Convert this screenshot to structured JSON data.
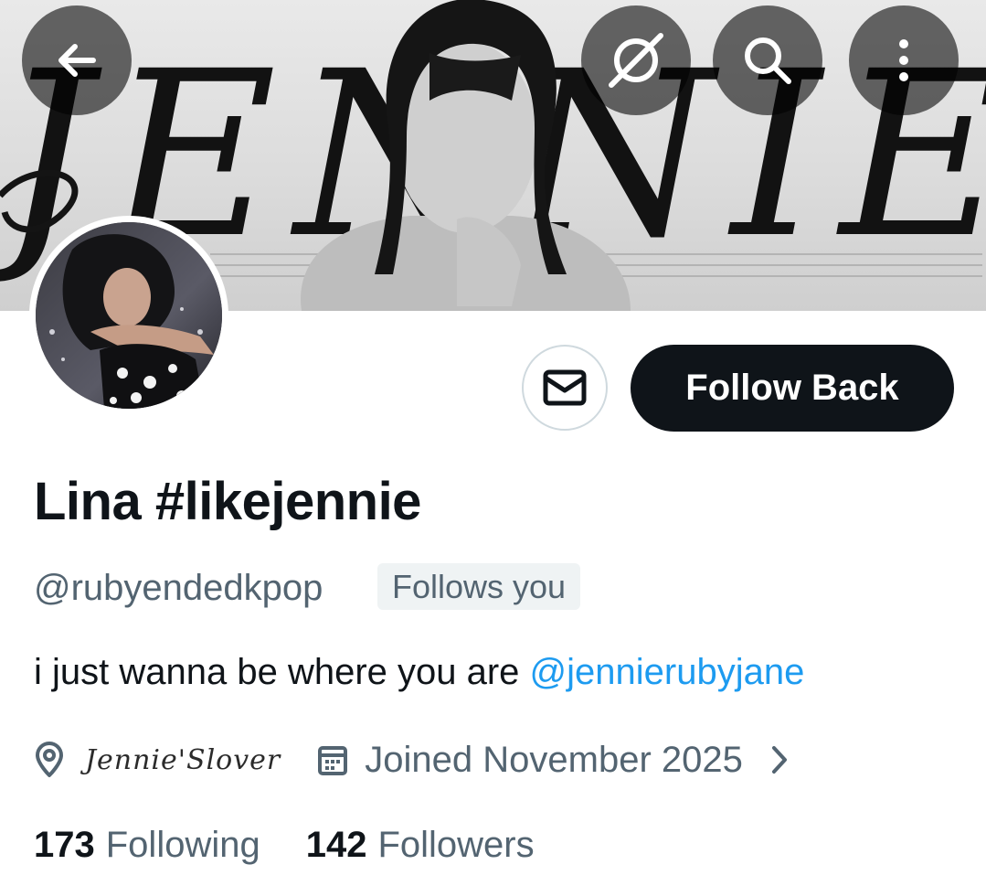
{
  "banner": {
    "wordmark": "JENNIE"
  },
  "nav": {
    "back_icon": "arrow-left-icon",
    "mute_icon": "no-grok-icon",
    "search_icon": "search-icon",
    "more_icon": "more-vertical-icon"
  },
  "profile": {
    "display_name": "Lina #likejennie",
    "handle": "@rubyendedkpop",
    "follows_you": "Follows you",
    "bio_text": "i just wanna be where you are ",
    "bio_mention": "@jennierubyjane",
    "location": "Jennie'Slover",
    "joined": "Joined November 2025",
    "following_count": "173",
    "following_label": "Following",
    "followers_count": "142",
    "followers_label": "Followers"
  },
  "actions": {
    "message_icon": "mail-icon",
    "follow_label": "Follow Back"
  },
  "colors": {
    "text_primary": "#0f1419",
    "text_secondary": "#536471",
    "link": "#1d9bf0",
    "button_dark": "#0f1419",
    "border": "#cfd9de"
  }
}
